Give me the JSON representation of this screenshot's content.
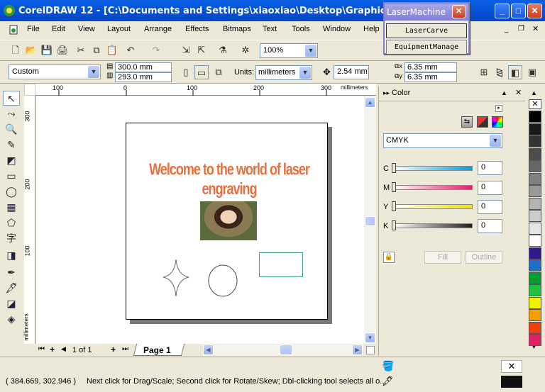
{
  "window": {
    "title": "CorelDRAW 12 - [C:\\Documents and Settings\\xiaoxiao\\Desktop\\Graphic1.cdr]"
  },
  "laser": {
    "title": "LaserMachine",
    "carve": "LaserCarve",
    "manage": "EquipmentManage"
  },
  "menu": [
    "File",
    "Edit",
    "View",
    "Layout",
    "Arrange",
    "Effects",
    "Bitmaps",
    "Text",
    "Tools",
    "Window",
    "Help"
  ],
  "standard": {
    "zoom": "100%"
  },
  "property": {
    "paper": "Custom",
    "width": "300.0 mm",
    "height": "293.0 mm",
    "units_label": "Units:",
    "units": "millimeters",
    "nudge": "2.54 mm",
    "dup_x": "6.35 mm",
    "dup_y": "6.35 mm"
  },
  "ruler": {
    "h": [
      "100",
      "0",
      "100",
      "200",
      "300"
    ],
    "h_unit": "millimeters",
    "v": [
      "300",
      "200",
      "100"
    ],
    "v_unit": "millimeters"
  },
  "canvas": {
    "welcome": "Welcome to the world of laser engraving"
  },
  "pager": {
    "info": "1 of 1",
    "tab": "Page 1"
  },
  "color_docker": {
    "title": "Color",
    "model": "CMYK",
    "channels": [
      {
        "label": "C",
        "value": "0",
        "color": "#00a0e0"
      },
      {
        "label": "M",
        "value": "0",
        "color": "#e0206a"
      },
      {
        "label": "Y",
        "value": "0",
        "color": "#f0e000"
      },
      {
        "label": "K",
        "value": "0",
        "color": "#202020"
      }
    ],
    "fill": "Fill",
    "outline": "Outline"
  },
  "palette": [
    "#ffffff",
    "#000000",
    "#1a1a1a",
    "#333333",
    "#4d4d4d",
    "#666666",
    "#808080",
    "#999999",
    "#b3b3b3",
    "#cccccc",
    "#e6e6e6",
    "#ffffff",
    "#2e1a8c",
    "#1e6ec8",
    "#00a030",
    "#20c040",
    "#f0f000",
    "#f0a000",
    "#f04010",
    "#e02060"
  ],
  "status": {
    "coords": "( 384.669, 302.946 )",
    "hint": "Next click for Drag/Scale; Second click for Rotate/Skew; Dbl-clicking tool selects all o..."
  }
}
